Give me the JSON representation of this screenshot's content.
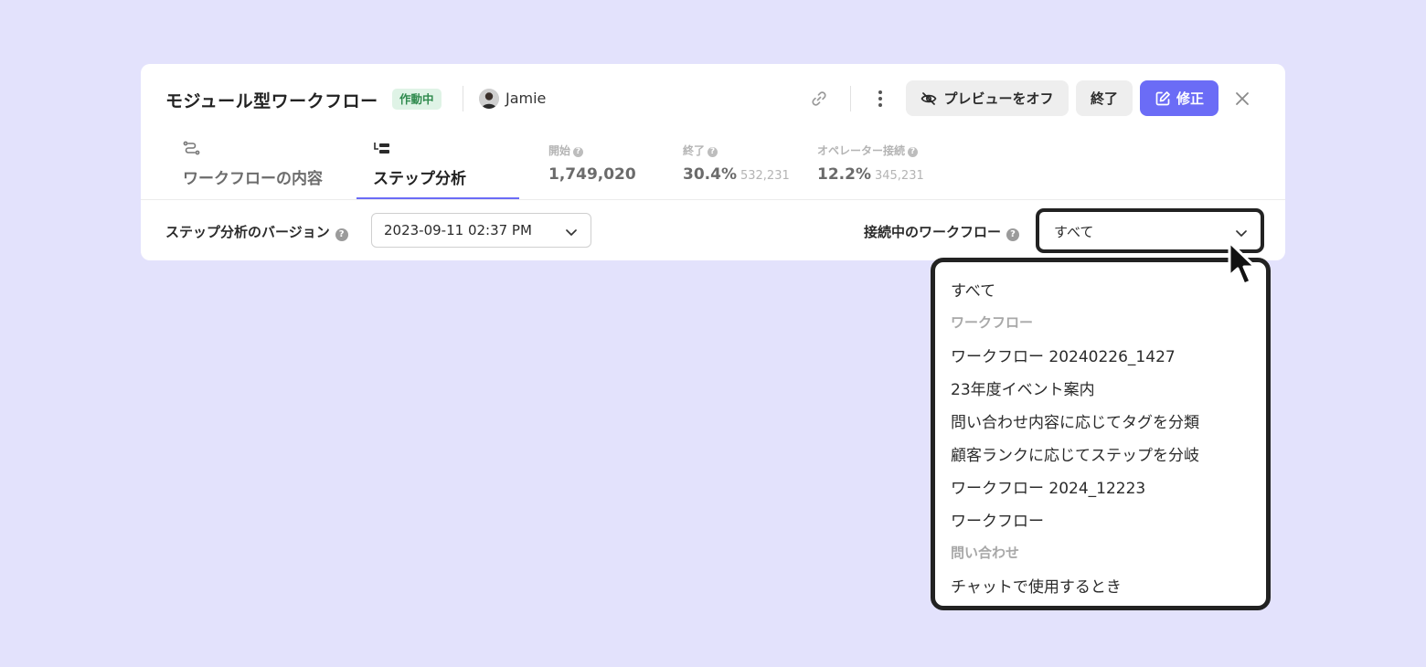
{
  "header": {
    "title": "モジュール型ワークフロー",
    "status_badge": "作動中",
    "user_name": "Jamie",
    "preview_off_label": "プレビューをオフ",
    "end_label": "終了",
    "edit_label": "修正"
  },
  "tabs": [
    {
      "label": "ワークフローの内容",
      "icon": "workflow-icon",
      "active": false
    },
    {
      "label": "ステップ分析",
      "icon": "step-analysis-icon",
      "active": true
    }
  ],
  "stats": {
    "start": {
      "label": "開始",
      "value": "1,749,020"
    },
    "end": {
      "label": "終了",
      "value": "30.4%",
      "sub": "532,231"
    },
    "operator": {
      "label": "オペレーター接続",
      "value": "12.2%",
      "sub": "345,231"
    }
  },
  "filters": {
    "version_label": "ステップ分析のバージョン",
    "version_value": "2023-09-11 02:37 PM",
    "connected_label": "接続中のワークフロー",
    "connected_value": "すべて"
  },
  "dropdown": {
    "all": "すべて",
    "group1": "ワークフロー",
    "items1": [
      "ワークフロー 20240226_1427",
      "23年度イベント案内",
      "問い合わせ内容に応じてタグを分類",
      "顧客ランクに応じてステップを分岐",
      "ワークフロー 2024_12223",
      "ワークフロー"
    ],
    "group2": "問い合わせ",
    "items2": [
      "チャットで使用するとき"
    ]
  },
  "colors": {
    "background": "#e3e2fc",
    "accent": "#6b6cf6",
    "badge_bg": "#dff3e6",
    "badge_text": "#2f8a4d"
  }
}
